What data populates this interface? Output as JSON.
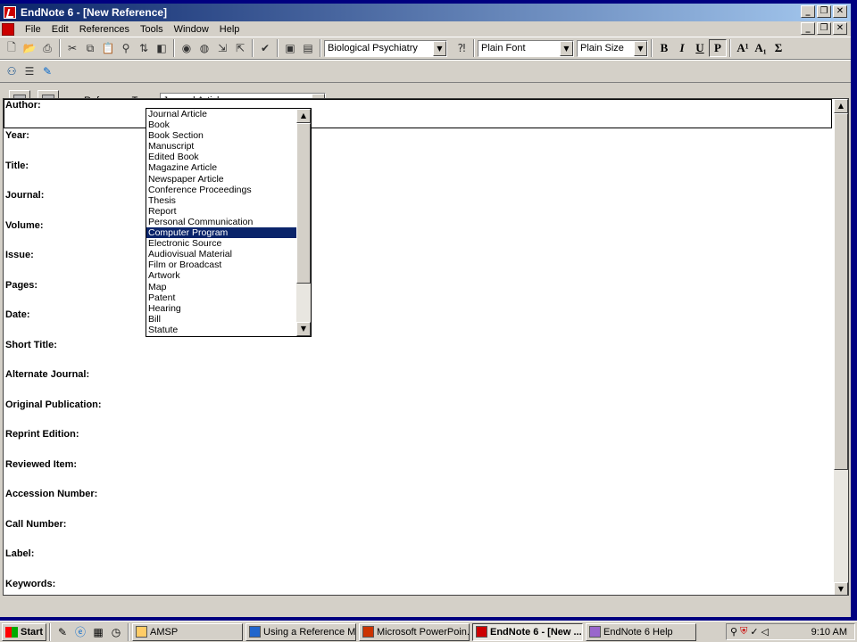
{
  "window": {
    "title": "EndNote 6 - [New Reference]",
    "min": "_",
    "max": "❐",
    "close": "✕"
  },
  "menu": [
    "File",
    "Edit",
    "References",
    "Tools",
    "Window",
    "Help"
  ],
  "toolbar": {
    "style_value": "Biological Psychiatry",
    "font_value": "Plain Font",
    "size_value": "Plain Size",
    "bold": "B",
    "italic": "I",
    "underline": "U",
    "plain": "P",
    "superscript": "A¹",
    "subscript": "A₁",
    "symbol": "Σ"
  },
  "reference": {
    "type_label": "Reference Type:",
    "type_value": "Journal Article"
  },
  "fields": [
    "Author:",
    "Year:",
    "Title:",
    "Journal:",
    "Volume:",
    "Issue:",
    "Pages:",
    "Date:",
    "Short Title:",
    "Alternate Journal:",
    "Original Publication:",
    "Reprint Edition:",
    "Reviewed Item:",
    "Accession Number:",
    "Call Number:",
    "Label:",
    "Keywords:"
  ],
  "dropdown": {
    "items": [
      "Journal Article",
      "Book",
      "Book Section",
      "Manuscript",
      "Edited Book",
      "Magazine Article",
      "Newspaper Article",
      "Conference Proceedings",
      "Thesis",
      "Report",
      "Personal Communication",
      "Computer Program",
      "Electronic Source",
      "Audiovisual Material",
      "Film or Broadcast",
      "Artwork",
      "Map",
      "Patent",
      "Hearing",
      "Bill",
      "Statute"
    ],
    "selected": "Computer Program"
  },
  "taskbar": {
    "start": "Start",
    "tasks": [
      "AMSP",
      "Using a Reference M...",
      "Microsoft PowerPoin...",
      "EndNote 6 - [New ...",
      "EndNote 6 Help"
    ],
    "active_task": "EndNote 6 - [New ...",
    "clock": "9:10 AM"
  },
  "colors": {
    "desktop": "#000080",
    "titlebar": "#0a246a",
    "selection": "#0a246a",
    "face": "#d4d0c8"
  }
}
